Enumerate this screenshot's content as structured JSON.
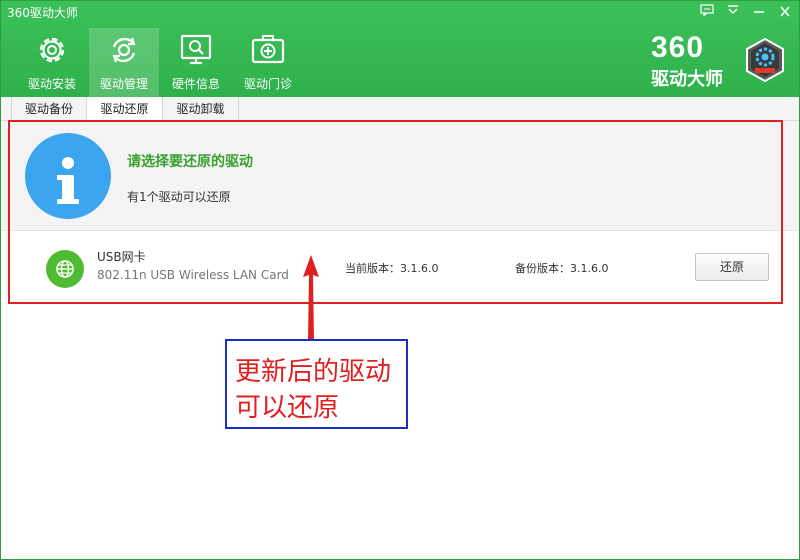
{
  "window": {
    "title": "360驱动大师",
    "controls": [
      "feedback-icon",
      "menu-icon",
      "minimize-icon",
      "close-icon"
    ]
  },
  "nav": {
    "items": [
      {
        "label": "驱动安装",
        "icon": "gear-icon",
        "active": false
      },
      {
        "label": "驱动管理",
        "icon": "refresh-gear-icon",
        "active": true
      },
      {
        "label": "硬件信息",
        "icon": "monitor-search-icon",
        "active": false
      },
      {
        "label": "驱动门诊",
        "icon": "medical-kit-icon",
        "active": false
      }
    ]
  },
  "brand": {
    "number": "360",
    "name": "驱动大师",
    "logo_icon": "hexagon-gear-logo"
  },
  "subtabs": {
    "items": [
      {
        "label": "驱动备份",
        "active": false
      },
      {
        "label": "驱动还原",
        "active": true
      },
      {
        "label": "驱动卸载",
        "active": false
      }
    ]
  },
  "info": {
    "icon": "info-icon",
    "title": "请选择要还原的驱动",
    "subtitle": "有1个驱动可以还原"
  },
  "drivers": [
    {
      "icon": "globe-icon",
      "name": "USB网卡",
      "description": "802.11n USB Wireless LAN Card",
      "current_version": "当前版本：3.1.6.0",
      "backup_version": "备份版本：3.1.6.0",
      "action_label": "还原"
    }
  ],
  "annotation": {
    "line1": "更新后的驱动",
    "line2": "可以还原"
  },
  "colors": {
    "header_green": "#36b853",
    "title_green": "#3aa02f",
    "info_blue": "#3ba6ef",
    "annotation_red": "#e02020",
    "annotation_blue": "#1a2fc4"
  }
}
